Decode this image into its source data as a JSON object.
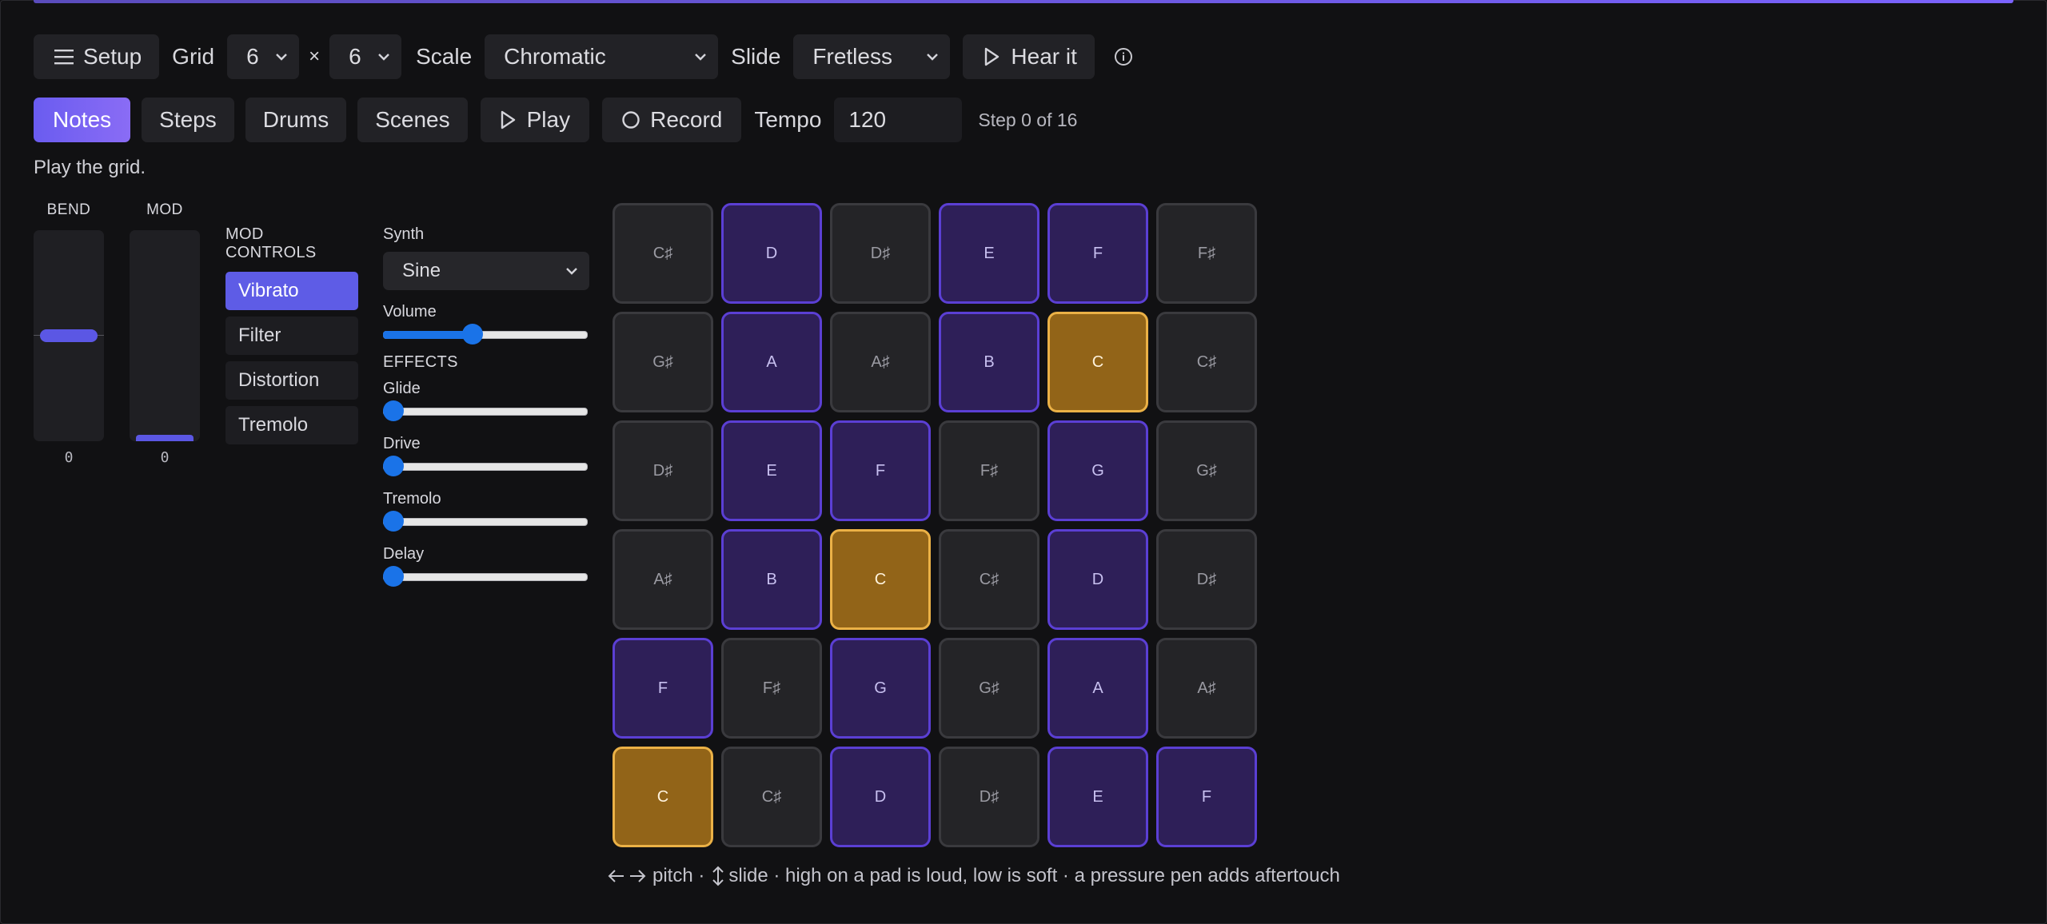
{
  "toolbar": {
    "setup_label": "Setup",
    "grid_label": "Grid",
    "grid_cols": "6",
    "times": "×",
    "grid_rows": "6",
    "scale_label": "Scale",
    "scale_value": "Chromatic",
    "slide_label": "Slide",
    "slide_value": "Fretless",
    "hear_label": "Hear it",
    "info_icon": "info-icon"
  },
  "tabs": {
    "notes": "Notes",
    "steps": "Steps",
    "drums": "Drums",
    "scenes": "Scenes",
    "play": "Play",
    "record": "Record",
    "tempo_label": "Tempo",
    "tempo_value": "120",
    "step_status": "Step 0 of 16"
  },
  "hint": "Play the grid.",
  "bend": {
    "label": "BEND",
    "value": "0",
    "level": 0.5
  },
  "mod": {
    "label": "MOD",
    "value": "0",
    "level": 0
  },
  "mod_controls": {
    "title": "MOD CONTROLS",
    "items": [
      "Vibrato",
      "Filter",
      "Distortion",
      "Tremolo"
    ],
    "active": "Vibrato"
  },
  "synth": {
    "label": "Synth",
    "value": "Sine",
    "volume_label": "Volume",
    "volume_level": 0.43,
    "effects_label": "EFFECTS",
    "effects": [
      {
        "label": "Glide",
        "level": 0
      },
      {
        "label": "Drive",
        "level": 0
      },
      {
        "label": "Tremolo",
        "level": 0
      },
      {
        "label": "Delay",
        "level": 0
      }
    ]
  },
  "pads": [
    [
      "C♯",
      "D",
      "D♯",
      "E",
      "F",
      "F♯"
    ],
    [
      "G♯",
      "A",
      "A♯",
      "B",
      "C",
      "C♯"
    ],
    [
      "D♯",
      "E",
      "F",
      "F♯",
      "G",
      "G♯"
    ],
    [
      "A♯",
      "B",
      "C",
      "C♯",
      "D",
      "D♯"
    ],
    [
      "F",
      "F♯",
      "G",
      "G♯",
      "A",
      "A♯"
    ],
    [
      "C",
      "C♯",
      "D",
      "D♯",
      "E",
      "F"
    ]
  ],
  "colors": {
    "accent": "#6a5cf0",
    "root": "#926418",
    "natural": "#2e1f58",
    "sharp": "#242427"
  },
  "footer": {
    "pitch_text": "pitch ·",
    "slide_text": "slide · high on a pad is loud, low is soft · a pressure pen adds aftertouch"
  }
}
